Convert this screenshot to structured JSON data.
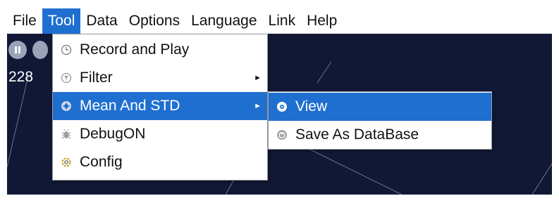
{
  "menubar": {
    "items": [
      "File",
      "Tool",
      "Data",
      "Options",
      "Language",
      "Link",
      "Help"
    ]
  },
  "canvas": {
    "readout_visible": "228",
    "background_color": "#111836"
  },
  "tool_menu": {
    "items": [
      {
        "label": "Record and Play",
        "icon": "clock-icon"
      },
      {
        "label": "Filter",
        "icon": "filter-icon",
        "submenu": true
      },
      {
        "label": "Mean And STD",
        "icon": "mean-std-icon",
        "submenu": true,
        "highlighted": true
      },
      {
        "label": "DebugON",
        "icon": "bug-icon"
      },
      {
        "label": "Config",
        "icon": "gear-icon"
      }
    ]
  },
  "submenu": {
    "items": [
      {
        "label": "View",
        "icon": "eye-icon",
        "highlighted": true
      },
      {
        "label": "Save As DataBase",
        "icon": "database-icon"
      }
    ]
  },
  "colors": {
    "highlight": "#1f6fd0",
    "canvas": "#111836"
  }
}
